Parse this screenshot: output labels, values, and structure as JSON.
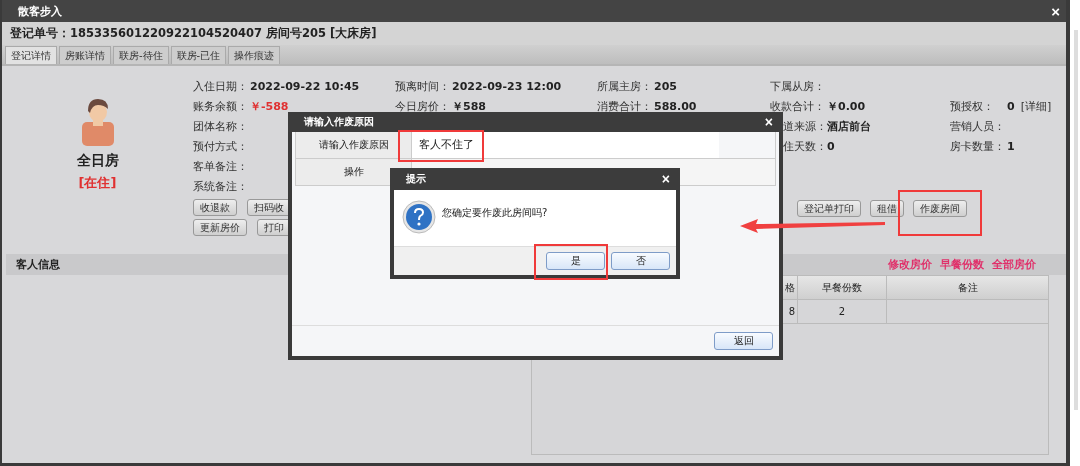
{
  "window": {
    "title": "散客步入",
    "close": "×"
  },
  "header": {
    "text": "登记单号：1853356012209221​04520407 房间号205 [大床房]"
  },
  "tabs": [
    {
      "label": "登记详情",
      "selected": true
    },
    {
      "label": "房账详情",
      "selected": false
    },
    {
      "label": "联房-待住",
      "selected": false
    },
    {
      "label": "联房-已住",
      "selected": false
    },
    {
      "label": "操作痕迹",
      "selected": false
    }
  ],
  "room": {
    "type": "全日房",
    "status": "[在住]"
  },
  "info_rows": [
    [
      {
        "label": "入住日期：",
        "value": "2022-09-22 10:45"
      },
      {
        "label": "预离时间：",
        "value": "2022-09-23 12:00"
      },
      {
        "label": "所属主房：",
        "value": "205"
      },
      {
        "label": "下属从房："
      },
      null
    ],
    [
      {
        "label": "账务余额：",
        "value": "￥-588",
        "color": "#e03030"
      },
      {
        "label": "今日房价：",
        "value": "￥588"
      },
      {
        "label": "消费合计：",
        "value": "588.00"
      },
      {
        "label": "收款合计：",
        "value": "￥0.00"
      },
      {
        "label": "预授权：",
        "value": "0",
        "extra": "[详细]"
      }
    ],
    [
      {
        "label": "团体名称："
      },
      null,
      null,
      {
        "label": "道来源：",
        "value": "酒店前台",
        "kind": "cut"
      },
      {
        "label": "营销人员："
      }
    ],
    [
      {
        "label": "预付方式："
      },
      null,
      null,
      {
        "label": "住天数：",
        "value": "0",
        "kind": "cut"
      },
      {
        "label": "房卡数量：",
        "value": "1"
      }
    ],
    [
      {
        "label": "客单备注："
      },
      null,
      null,
      null,
      null
    ],
    [
      {
        "label": "系统备注："
      },
      null,
      null,
      null,
      null
    ]
  ],
  "buttons_left": [
    [
      "收退款",
      "扫码收"
    ],
    [
      "更新房价",
      "打印"
    ]
  ],
  "buttons_right": [
    "登记单打印",
    "租借",
    "作废房间"
  ],
  "guest_section": {
    "title": "客人信息",
    "links": [
      "修改房价",
      "早餐份数",
      "全部房价"
    ]
  },
  "table": {
    "columns": [
      "格",
      "早餐份数",
      "备注"
    ],
    "rows": [
      [
        "8",
        "2"
      ]
    ]
  },
  "void_dialog": {
    "title": "请输入作废原因",
    "close": "×",
    "rows": [
      {
        "label": "请输入作废原因",
        "value": "客人不住了"
      },
      {
        "label": "操作"
      }
    ],
    "button": "返回"
  },
  "confirm_dialog": {
    "title": "提示",
    "close": "×",
    "message": "您确定要作废此房间吗?",
    "buttons": [
      "是",
      "否"
    ]
  }
}
